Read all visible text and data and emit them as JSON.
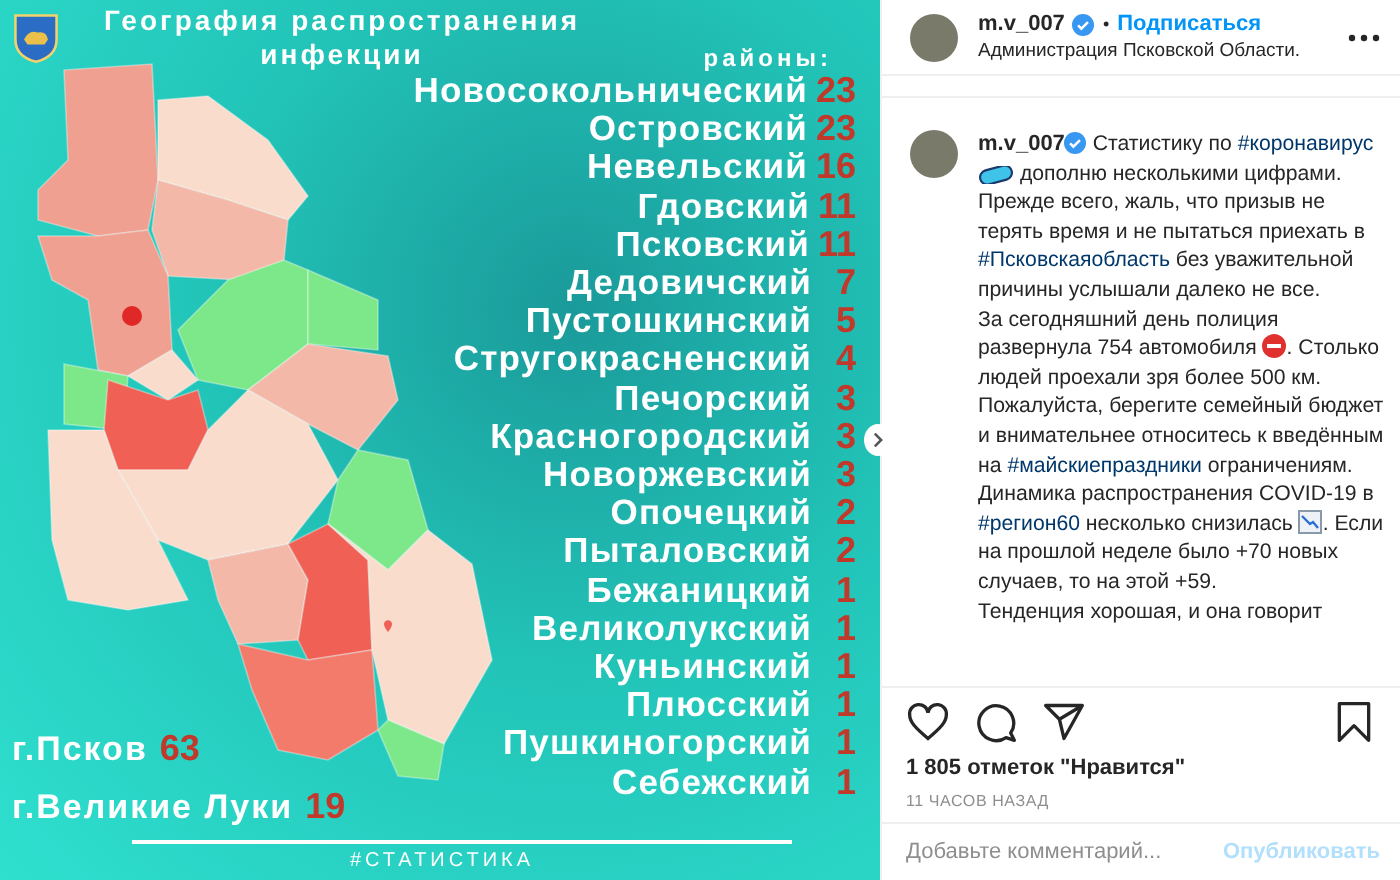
{
  "post_image": {
    "title": "География распространения инфекции",
    "list_heading": "районы:",
    "districts": [
      {
        "name": "Новосокольнический",
        "count": "23"
      },
      {
        "name": "Островский",
        "count": "23"
      },
      {
        "name": "Невельский",
        "count": "16"
      },
      {
        "name": "Гдовский",
        "count": "11"
      },
      {
        "name": "Псковский",
        "count": "11"
      },
      {
        "name": "Дедовичский",
        "count": "7"
      },
      {
        "name": "Пустошкинский",
        "count": "5"
      },
      {
        "name": "Стругокрасненский",
        "count": "4"
      },
      {
        "name": "Печорский",
        "count": "3"
      },
      {
        "name": "Красногородский",
        "count": "3"
      },
      {
        "name": "Новоржевский",
        "count": "3"
      },
      {
        "name": "Опочецкий",
        "count": "2"
      },
      {
        "name": "Пыталовский",
        "count": "2"
      },
      {
        "name": "Бежаницкий",
        "count": "1"
      },
      {
        "name": "Великолукский",
        "count": "1"
      },
      {
        "name": "Куньинский",
        "count": "1"
      },
      {
        "name": "Плюсский",
        "count": "1"
      },
      {
        "name": "Пушкиногорский",
        "count": "1"
      },
      {
        "name": "Себежский",
        "count": "1"
      }
    ],
    "cities": [
      {
        "name": "г.Псков",
        "count": "63"
      },
      {
        "name": "г.Великие Луки",
        "count": "19"
      }
    ],
    "hashtag": "#СТАТИСТИКА"
  },
  "post": {
    "header": {
      "username": "m.v_007",
      "verified": true,
      "separator": "•",
      "follow": "Подписаться",
      "location": "Администрация Псковской Области."
    },
    "caption": {
      "username": "m.v_007",
      "verified": true,
      "segments": [
        {
          "kind": "text",
          "text": "Статистику по "
        },
        {
          "kind": "tag",
          "text": "#коронавирус"
        },
        {
          "kind": "pill"
        },
        {
          "kind": "text",
          "text": " дополню несколькими цифрами.\nПрежде всего, жаль, что призыв не терять время и не пытаться приехать в "
        },
        {
          "kind": "tag",
          "text": "#Псковскаяобласть"
        },
        {
          "kind": "text",
          "text": " без уважительной причины услышали далеко не все.\nЗа сегодняшний день полиция развернула 754 автомобиля "
        },
        {
          "kind": "stop"
        },
        {
          "kind": "text",
          "text": ". Столько людей проехали зря более 500 км. Пожалуйста, берегите семейный бюджет и внимательнее относитесь к введённым на "
        },
        {
          "kind": "tag",
          "text": "#майскиепраздники"
        },
        {
          "kind": "text",
          "text": " ограничениям.\nДинамика распространения COVID-19 в "
        },
        {
          "kind": "tag",
          "text": "#регион60"
        },
        {
          "kind": "text",
          "text": " несколько снизилась "
        },
        {
          "kind": "chart"
        },
        {
          "kind": "text",
          "text": ". Если на прошлой неделе было +70 новых случаев, то на этой +59.\nТенденция хорошая, и она говорит"
        }
      ]
    },
    "likes": "1 805 отметок \"Нравится\"",
    "time": "11 ЧАСОВ НАЗАД",
    "comment": {
      "placeholder": "Добавьте комментарий...",
      "submit": "Опубликовать",
      "submit_disabled": true
    }
  }
}
